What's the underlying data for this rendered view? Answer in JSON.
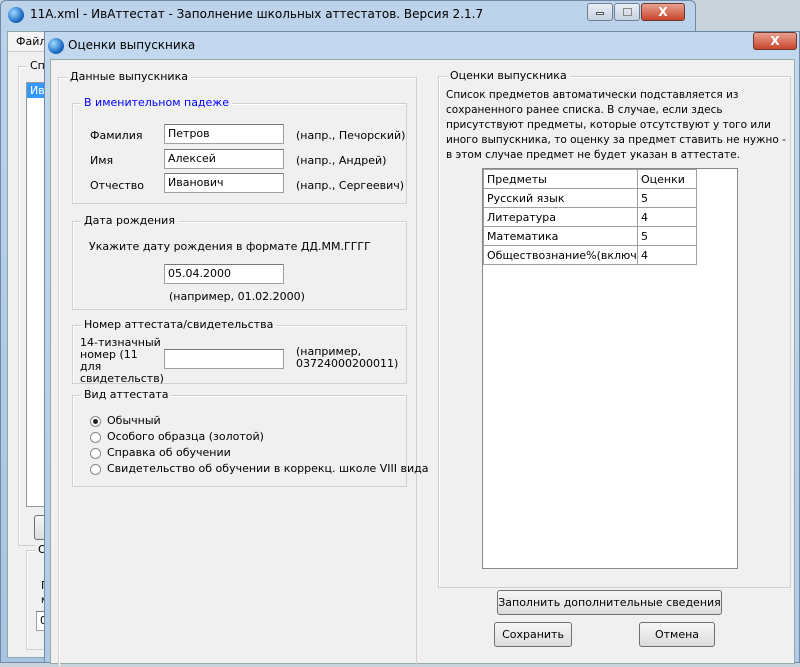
{
  "main_window": {
    "title": "11A.xml - ИвАттестат - Заполнение школьных аттестатов. Версия 2.1.7",
    "menu_file": "Файл",
    "list_group": "Спи",
    "list_item": "Ив",
    "bottom_group": "О",
    "bottom_label1": "П",
    "bottom_label2": "м",
    "bottom_value": "0"
  },
  "dialog": {
    "title": "Оценки выпускника",
    "graduate": {
      "legend": "Данные выпускника",
      "name_group": {
        "legend": "В именительном падеже",
        "legend_color": "#0000ff",
        "fields": [
          {
            "label": "Фамилия",
            "value": "Петров",
            "hint": "(напр., Печорский)"
          },
          {
            "label": "Имя",
            "value": "Алексей",
            "hint": "(напр., Андрей)"
          },
          {
            "label": "Отчество",
            "value": "Иванович",
            "hint": "(напр., Сергеевич)"
          }
        ]
      },
      "birth": {
        "legend": "Дата рождения",
        "instruction": "Укажите дату рождения в формате ДД.ММ.ГГГГ",
        "value": "05.04.2000",
        "hint": "(например, 01.02.2000)"
      },
      "certificate": {
        "legend": "Номер аттестата/свидетельства",
        "label": "14-тизначный номер (11 для свидетельств)",
        "value": "",
        "hint": "(например, 03724000200011)"
      },
      "type": {
        "legend": "Вид аттестата",
        "selected": 0,
        "options": [
          "Обычный",
          "Особого образца (золотой)",
          "Справка об обучении",
          "Свидетельство об обучении в коррекц. школе VIII вида"
        ]
      }
    },
    "grades": {
      "legend": "Оценки выпускника",
      "description": "Список предметов автоматически подставляется из сохраненного ранее списка. В случае, если здесь присутствуют предметы, которые отсутствуют у того или иного выпускника, то оценку за предмет ставить не нужно - в этом случае предмет не будет указан в аттестате.",
      "columns": [
        "Предметы",
        "Оценки"
      ],
      "rows": [
        {
          "subject": "Русский язык",
          "grade": "5"
        },
        {
          "subject": "Литература",
          "grade": "4"
        },
        {
          "subject": "Математика",
          "grade": "5"
        },
        {
          "subject": "Обществознание%(включая экономику и право)",
          "grade": "4"
        }
      ]
    },
    "buttons": {
      "fill_extra": "Заполнить дополнительные сведения",
      "save": "Сохранить",
      "cancel": "Отмена"
    }
  }
}
